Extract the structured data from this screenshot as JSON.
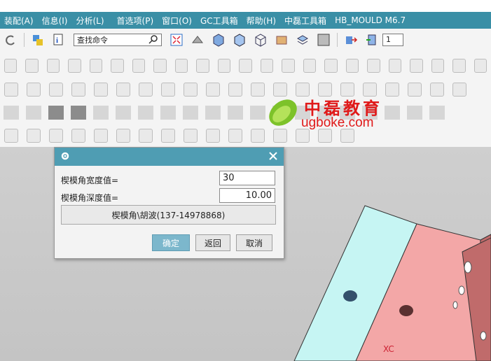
{
  "menu": {
    "items": [
      "装配(A)",
      "信息(I)",
      "分析(L)",
      "首选项(P)",
      "窗口(O)",
      "GC工具箱",
      "帮助(H)",
      "中磊工具箱",
      "HB_MOULD M6.7"
    ]
  },
  "toolbar": {
    "search_placeholder": "查找命令",
    "right_value": "1"
  },
  "logo": {
    "cn_text": "中磊教育",
    "url_text": "ugboke.com"
  },
  "viewport": {
    "axis_label": "XC"
  },
  "dialog": {
    "width_label": "楔模角宽度值=",
    "width_value": "30",
    "depth_label": "楔模角深度值=",
    "depth_value": "10.00",
    "info_label": "楔模角\\胡波(137-14978868)",
    "ok_label": "确定",
    "back_label": "返回",
    "cancel_label": "取消"
  },
  "colors": {
    "menubar": "#3a8fa6",
    "dialog_title": "#4f9db3",
    "ok_button": "#7cb7cc",
    "part_light": "#c6f5f3",
    "part_pink": "#f3a7a7",
    "part_dark": "#bf6a6a",
    "logo_red": "#e01a1a",
    "logo_green": "#7dc22a"
  }
}
